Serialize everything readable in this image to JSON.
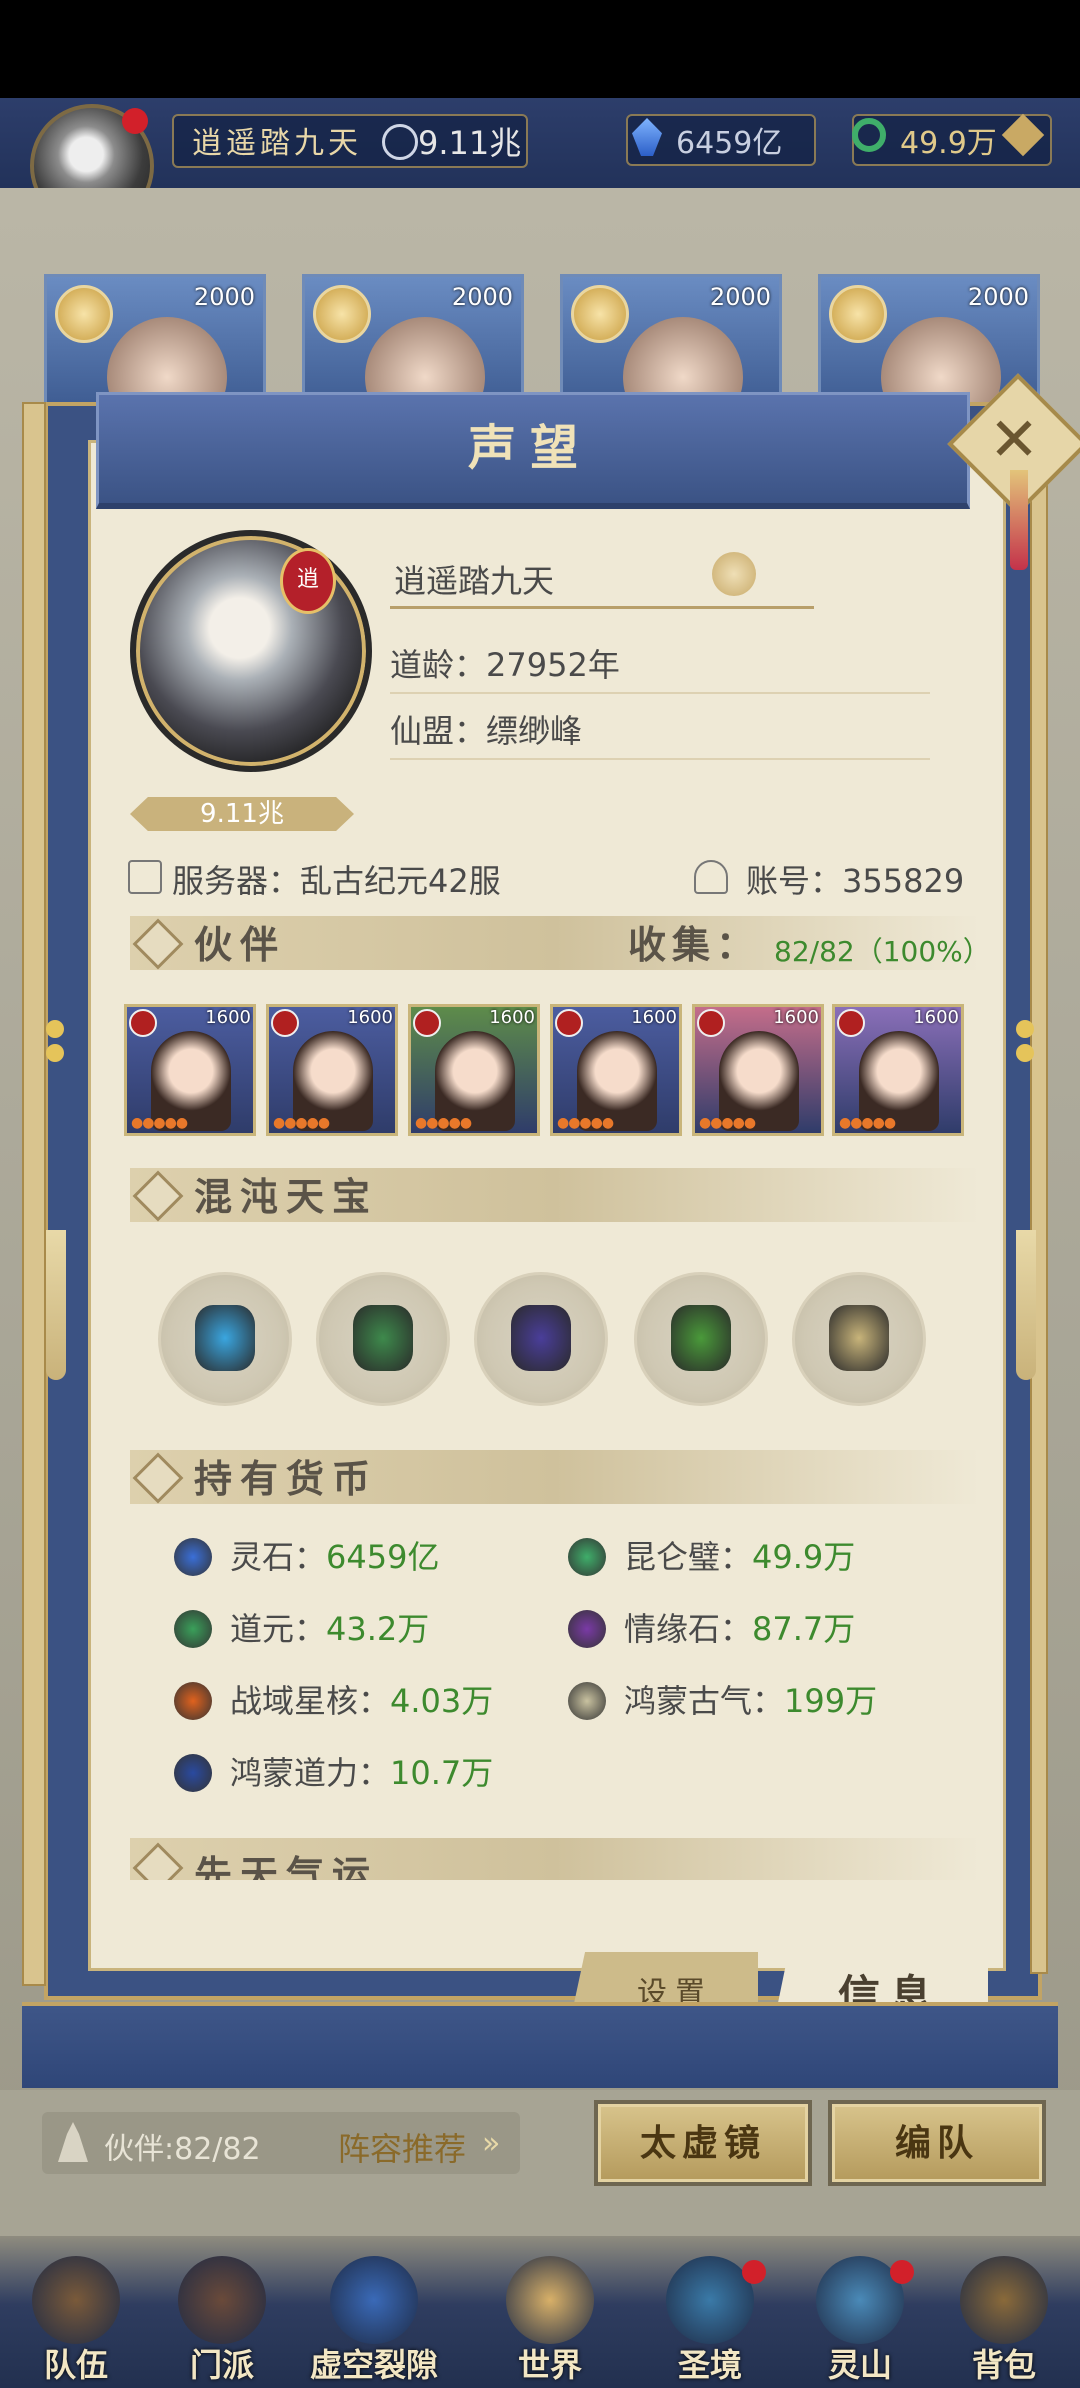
{
  "topbar": {
    "player_name": "逍遥踏九天",
    "power": "9.11兆",
    "spirit_stone": "6459亿",
    "jade": "49.9万"
  },
  "top_cards": [
    {
      "value": "2000"
    },
    {
      "value": "2000"
    },
    {
      "value": "2000"
    },
    {
      "value": "2000"
    }
  ],
  "modal": {
    "title": "声望",
    "profile": {
      "name": "逍遥踏九天",
      "seal_char": "逍",
      "dao_age_label": "道龄：",
      "dao_age_value": "27952年",
      "alliance_label": "仙盟：",
      "alliance_value": "缥缈峰",
      "power": "9.11兆",
      "server_label": "服务器：",
      "server_value": "乱古纪元42服",
      "account_label": "账号：",
      "account_value": "355829"
    },
    "partners": {
      "title": "伙伴",
      "collect_label": "收集：",
      "collect_value": "82/82（100%）",
      "cards": [
        {
          "level": "1600",
          "bg": "#4c5da0"
        },
        {
          "level": "1600",
          "bg": "#4c5da0"
        },
        {
          "level": "1600",
          "bg": "#5e8c4a"
        },
        {
          "level": "1600",
          "bg": "#4c5da0"
        },
        {
          "level": "1600",
          "bg": "#c46d8a"
        },
        {
          "level": "1600",
          "bg": "#8a6fb8"
        }
      ]
    },
    "treasures": {
      "title": "混沌天宝",
      "items": [
        {
          "icon": "gourd-icon",
          "color": "#3aa6e0"
        },
        {
          "icon": "cauldron-icon",
          "color": "#3e8a4c"
        },
        {
          "icon": "orb-icon",
          "color": "#4a3e9a"
        },
        {
          "icon": "dragon-seal-icon",
          "color": "#4a9a3a"
        },
        {
          "icon": "vase-icon",
          "color": "#c8b47a"
        }
      ]
    },
    "currency": {
      "title": "持有货币",
      "items": [
        {
          "label": "灵石：",
          "value": "6459亿",
          "icon": "spirit-stone-icon",
          "color": "#3a6fd8"
        },
        {
          "label": "昆仑璧：",
          "value": "49.9万",
          "icon": "kunlun-jade-icon",
          "color": "#3fae6a"
        },
        {
          "label": "道元：",
          "value": "43.2万",
          "icon": "dao-yuan-icon",
          "color": "#3aa05a"
        },
        {
          "label": "情缘石：",
          "value": "87.7万",
          "icon": "love-stone-icon",
          "color": "#7a3aa6"
        },
        {
          "label": "战域星核：",
          "value": "4.03万",
          "icon": "star-core-icon",
          "color": "#e0621e"
        },
        {
          "label": "鸿蒙古气：",
          "value": "199万",
          "icon": "ancient-qi-icon",
          "color": "#c9c2a0"
        },
        {
          "label": "鸿蒙道力：",
          "value": "10.7万",
          "icon": "dao-power-icon",
          "color": "#2a4aa0"
        }
      ]
    },
    "next_section_title": "先天气运",
    "tabs": {
      "settings": "设置",
      "info": "信息"
    }
  },
  "bottom": {
    "partner_count": "伙伴:82/82",
    "recommend": "阵容推荐",
    "mirror_button": "太虚镜",
    "team_button": "编队"
  },
  "nav": [
    {
      "label": "队伍",
      "color": "#7a5a3a"
    },
    {
      "label": "门派",
      "color": "#6a4a3a"
    },
    {
      "label": "虚空裂隙",
      "color": "#3a6ab8"
    },
    {
      "label": "世界",
      "color": "#d8b068"
    },
    {
      "label": "圣境",
      "color": "#3a7aa8"
    },
    {
      "label": "灵山",
      "color": "#4a8ab8"
    },
    {
      "label": "背包",
      "color": "#8a6a3a"
    }
  ]
}
